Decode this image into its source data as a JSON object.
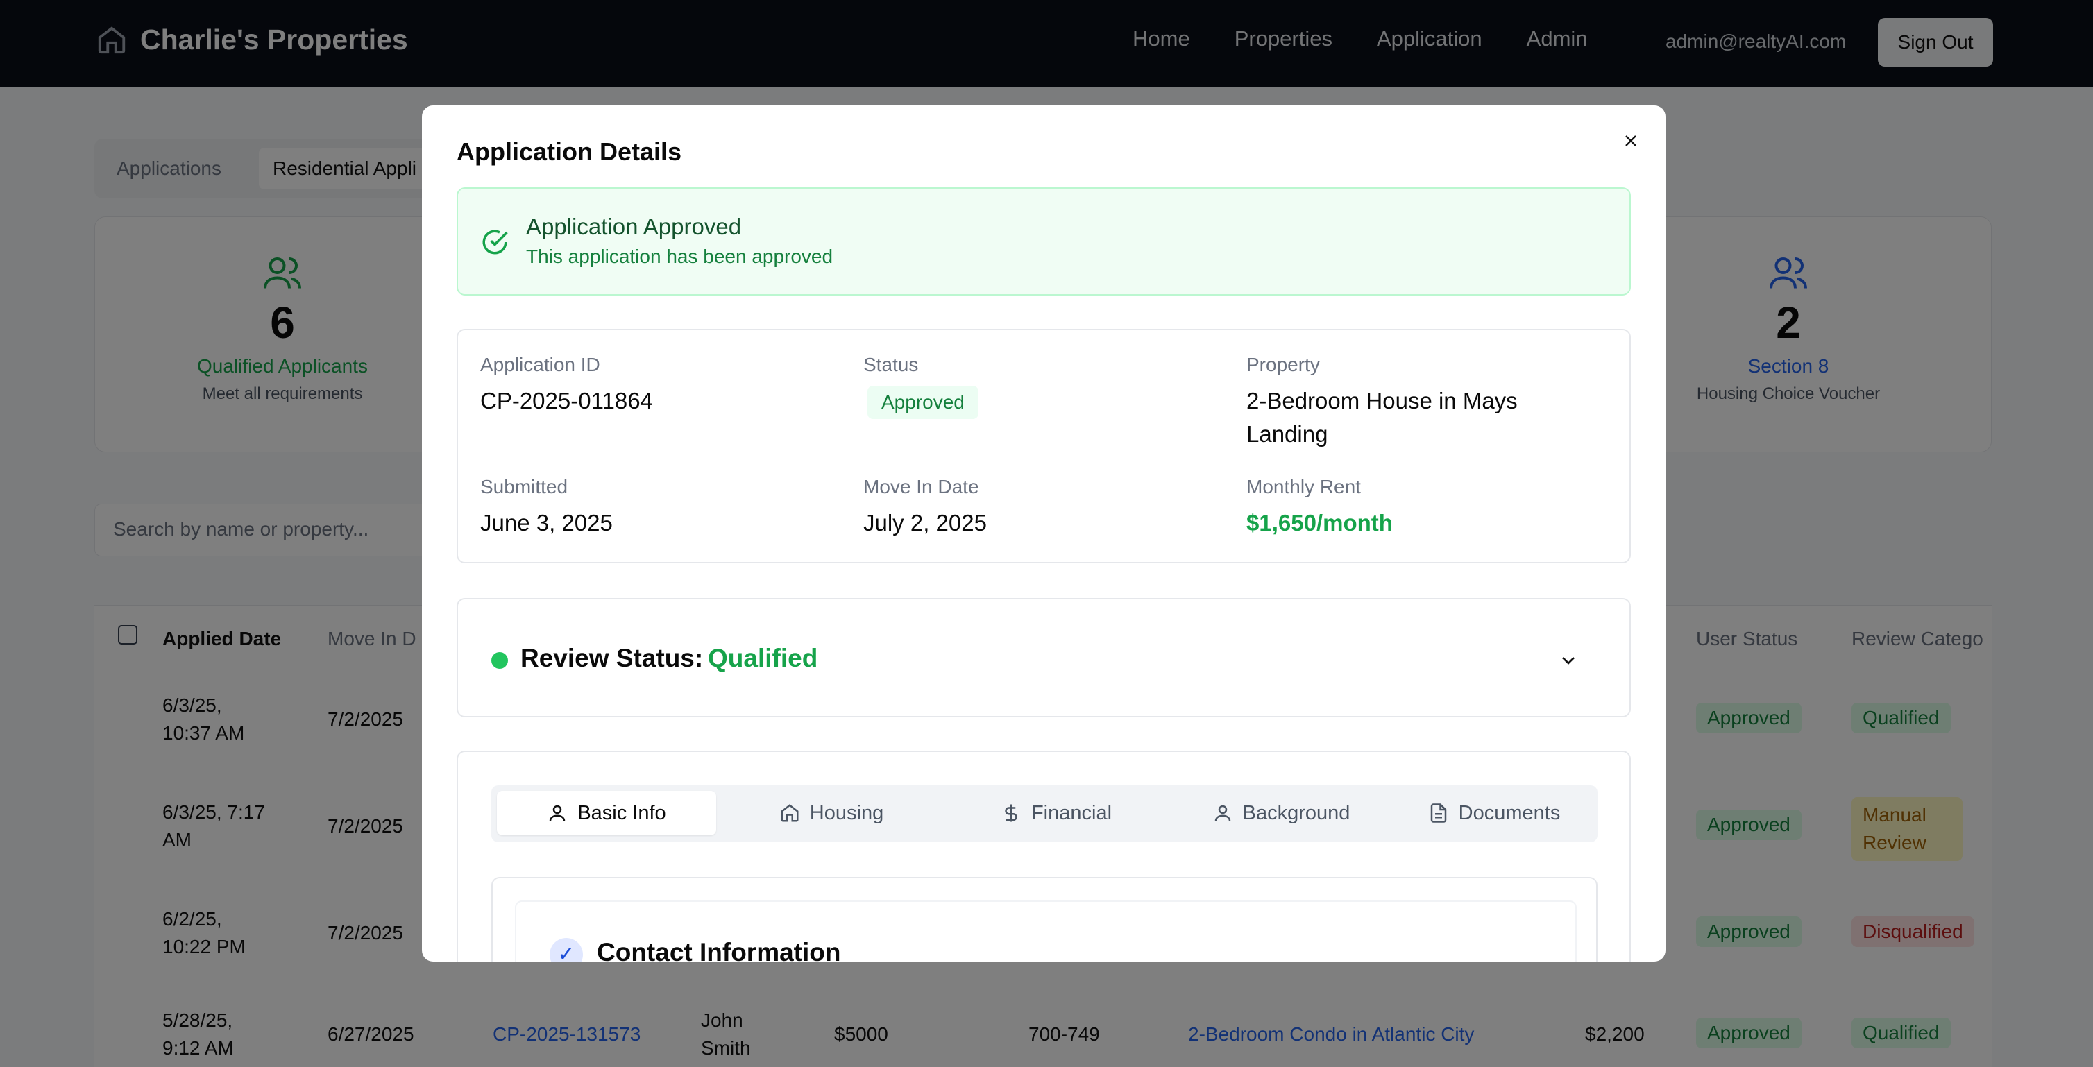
{
  "header": {
    "brand": "Charlie's Properties",
    "nav": [
      "Home",
      "Properties",
      "Application",
      "Admin"
    ],
    "user_email": "admin@realtyAI.com",
    "signout_label": "Sign Out"
  },
  "background": {
    "tabs": [
      "Applications",
      "Residential Appli"
    ],
    "stats": [
      {
        "num": "6",
        "label": "Qualified Applicants",
        "sub": "Meet all requirements",
        "color": "#16a34a"
      },
      {
        "num": "2",
        "label": "Section 8",
        "sub": "Housing Choice Voucher",
        "color": "#2563eb"
      }
    ],
    "search_placeholder": "Search by name or property...",
    "columns": [
      "Applied Date",
      "Move In D",
      "User Status",
      "Review Catego"
    ],
    "rows": [
      {
        "date": "6/3/25, 10:37 AM",
        "move_in": "7/2/2025",
        "user_status": "Approved",
        "review": "Qualified"
      },
      {
        "date": "6/3/25, 7:17 AM",
        "move_in": "7/2/2025",
        "user_status": "Approved",
        "review": "Manual Review"
      },
      {
        "date": "6/2/25, 10:22 PM",
        "move_in": "7/2/2025",
        "user_status": "Approved",
        "review": "Disqualified"
      },
      {
        "date": "5/28/25, 9:12 AM",
        "move_in": "6/27/2025",
        "app_id": "CP-2025-131573",
        "name": "John Smith",
        "income": "$5000",
        "credit": "700-749",
        "property": "2-Bedroom Condo in Atlantic City",
        "rent": "$2,200",
        "user_status": "Approved",
        "review": "Qualified"
      }
    ]
  },
  "modal": {
    "title": "Application Details",
    "alert": {
      "title": "Application Approved",
      "subtitle": "This application has been approved"
    },
    "details": {
      "app_id_label": "Application ID",
      "app_id": "CP-2025-011864",
      "status_label": "Status",
      "status": "Approved",
      "property_label": "Property",
      "property": "2-Bedroom House in Mays Landing",
      "submitted_label": "Submitted",
      "submitted": "June 3, 2025",
      "move_in_label": "Move In Date",
      "move_in": "July 2, 2025",
      "rent_label": "Monthly Rent",
      "rent": "$1,650/month"
    },
    "review": {
      "label": "Review Status:",
      "value": "Qualified"
    },
    "tabs": [
      "Basic Info",
      "Housing",
      "Financial",
      "Background",
      "Documents"
    ],
    "section_title": "Contact Information",
    "check": "✓"
  }
}
